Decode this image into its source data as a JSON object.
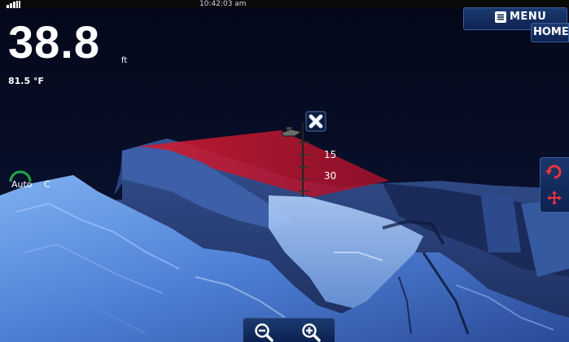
{
  "status": {
    "time": "10:42:03 am"
  },
  "toolbar": {
    "menu_label": "MENU",
    "home_label": "HOME"
  },
  "readouts": {
    "depth": "38.8",
    "depth_unit": "ft",
    "temperature": "81.5 °F"
  },
  "autopilot": {
    "label": "Auto",
    "mode": "C"
  },
  "depth_markers": [
    "15",
    "30"
  ],
  "icons": {
    "signal": "signal-icon",
    "menu": "menu-icon",
    "rotate": "rotate-icon",
    "pan": "pan-move-icon",
    "zoom_out": "zoom-out-icon",
    "zoom_in": "zoom-in-icon",
    "cursor": "cursor-x-icon",
    "boat": "boat-icon"
  },
  "colors": {
    "accent": "#1b3a70",
    "sonar_plane": "#c0182c",
    "terrain": "#4f7fd0"
  }
}
